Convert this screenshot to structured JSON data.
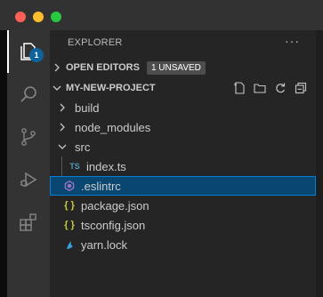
{
  "window": {
    "controls": [
      "close",
      "minimize",
      "maximize"
    ]
  },
  "activity_bar": {
    "items": [
      {
        "name": "explorer",
        "icon": "files-icon",
        "active": true,
        "badge": "1"
      },
      {
        "name": "search",
        "icon": "search-icon"
      },
      {
        "name": "source-control",
        "icon": "source-control-icon"
      },
      {
        "name": "run-debug",
        "icon": "debug-icon"
      },
      {
        "name": "extensions",
        "icon": "extensions-icon"
      }
    ]
  },
  "explorer": {
    "title": "EXPLORER",
    "more_label": "···",
    "open_editors": {
      "label": "OPEN EDITORS",
      "badge": "1 UNSAVED"
    },
    "project": {
      "name": "MY-NEW-PROJECT",
      "tool_icons": [
        "new-file-icon",
        "new-folder-icon",
        "refresh-icon",
        "collapse-all-icon"
      ]
    },
    "tree": [
      {
        "label": "build",
        "type": "folder",
        "expanded": false
      },
      {
        "label": "node_modules",
        "type": "folder",
        "expanded": false
      },
      {
        "label": "src",
        "type": "folder",
        "expanded": true
      },
      {
        "label": "index.ts",
        "type": "file",
        "icon_text": "TS",
        "parent": "src"
      },
      {
        "label": ".eslintrc",
        "type": "file",
        "icon": "eslint-icon",
        "selected": true
      },
      {
        "label": "package.json",
        "type": "file",
        "icon_text": "{ }"
      },
      {
        "label": "tsconfig.json",
        "type": "file",
        "icon_text": "{ }"
      },
      {
        "label": "yarn.lock",
        "type": "file",
        "icon": "yarn-icon"
      }
    ]
  },
  "colors": {
    "accent": "#007fd4",
    "selection": "#094771",
    "badge": "#0e639c",
    "ts_icon": "#519aba",
    "json_icon": "#cbcb41",
    "eslint_icon": "#a074c4"
  }
}
